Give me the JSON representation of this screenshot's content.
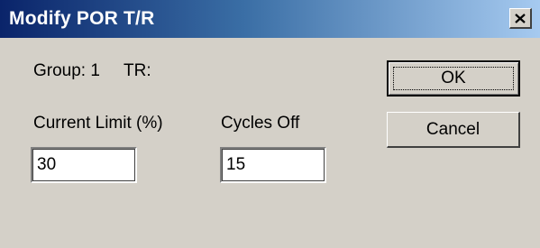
{
  "window": {
    "title": "Modify POR T/R",
    "close_icon": "close-icon"
  },
  "info": {
    "group_label": "Group: 1",
    "tr_label": "TR:"
  },
  "fields": {
    "current_limit": {
      "label": "Current Limit (%)",
      "value": "30"
    },
    "cycles_off": {
      "label": "Cycles Off",
      "value": "15"
    }
  },
  "buttons": {
    "ok": "OK",
    "cancel": "Cancel"
  }
}
